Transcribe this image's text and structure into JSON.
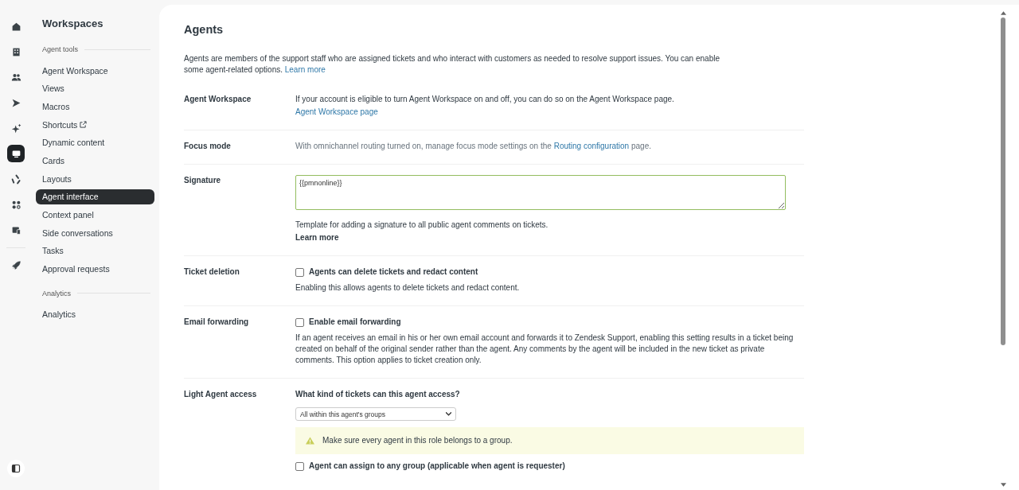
{
  "rail": {
    "items": [
      {
        "selected": false
      },
      {
        "selected": false
      },
      {
        "selected": false
      },
      {
        "selected": false
      },
      {
        "selected": false
      },
      {
        "selected": true
      },
      {
        "selected": false
      },
      {
        "selected": false
      },
      {
        "selected": false
      },
      {
        "selected": false
      }
    ]
  },
  "nav": {
    "title": "Workspaces",
    "sections": [
      {
        "heading": "Agent tools",
        "items": [
          {
            "label": "Agent Workspace",
            "selected": false,
            "external": false
          },
          {
            "label": "Views",
            "selected": false,
            "external": false
          },
          {
            "label": "Macros",
            "selected": false,
            "external": false
          },
          {
            "label": "Shortcuts",
            "selected": false,
            "external": true
          },
          {
            "label": "Dynamic content",
            "selected": false,
            "external": false
          },
          {
            "label": "Cards",
            "selected": false,
            "external": false
          },
          {
            "label": "Layouts",
            "selected": false,
            "external": false
          },
          {
            "label": "Agent interface",
            "selected": true,
            "external": false
          },
          {
            "label": "Context panel",
            "selected": false,
            "external": false
          },
          {
            "label": "Side conversations",
            "selected": false,
            "external": false
          },
          {
            "label": "Tasks",
            "selected": false,
            "external": false
          },
          {
            "label": "Approval requests",
            "selected": false,
            "external": false
          }
        ]
      },
      {
        "heading": "Analytics",
        "items": [
          {
            "label": "Analytics",
            "selected": false,
            "external": false
          }
        ]
      }
    ]
  },
  "page": {
    "title": "Agents",
    "intro": "Agents are members of the support staff who are assigned tickets and who interact with customers as needed to resolve support issues. You can enable some agent-related options.",
    "intro_link": "Learn more",
    "sections": [
      {
        "kind": "text_link",
        "label": "Agent Workspace",
        "text": "If your account is eligible to turn Agent Workspace on and off, you can do so on the Agent Workspace page.",
        "link": "Agent Workspace page"
      },
      {
        "kind": "inline_link",
        "label": "Focus mode",
        "text_before": "With omnichannel routing turned on, manage focus mode settings on the",
        "link": "Routing configuration",
        "text_after": "page."
      },
      {
        "kind": "textarea",
        "label": "Signature",
        "value": "{{pmnonline}}",
        "hint": "Template for adding a signature to all public agent comments on tickets.",
        "link": "Learn more"
      },
      {
        "kind": "checkbox",
        "label": "Ticket deletion",
        "option": "Agents can delete tickets and redact content",
        "checked": false,
        "description": "Enabling this allows agents to delete tickets and redact content."
      },
      {
        "kind": "checkbox",
        "label": "Email forwarding",
        "option": "Enable email forwarding",
        "checked": false,
        "description": "If an agent receives an email in his or her own email account and forwards it to Zendesk Support, enabling this setting results in a ticket being created on behalf of the original sender rather than the agent. Any comments by the agent will be included in the new ticket as private comments. This option applies to ticket creation only."
      },
      {
        "kind": "access",
        "label": "Light Agent access",
        "question": "What kind of tickets can this agent access?",
        "select": "All within this agent's groups",
        "warning": "Make sure every agent in this role belongs to a group.",
        "option": "Agent can assign to any group (applicable when agent is requester)",
        "checked": false
      }
    ]
  }
}
